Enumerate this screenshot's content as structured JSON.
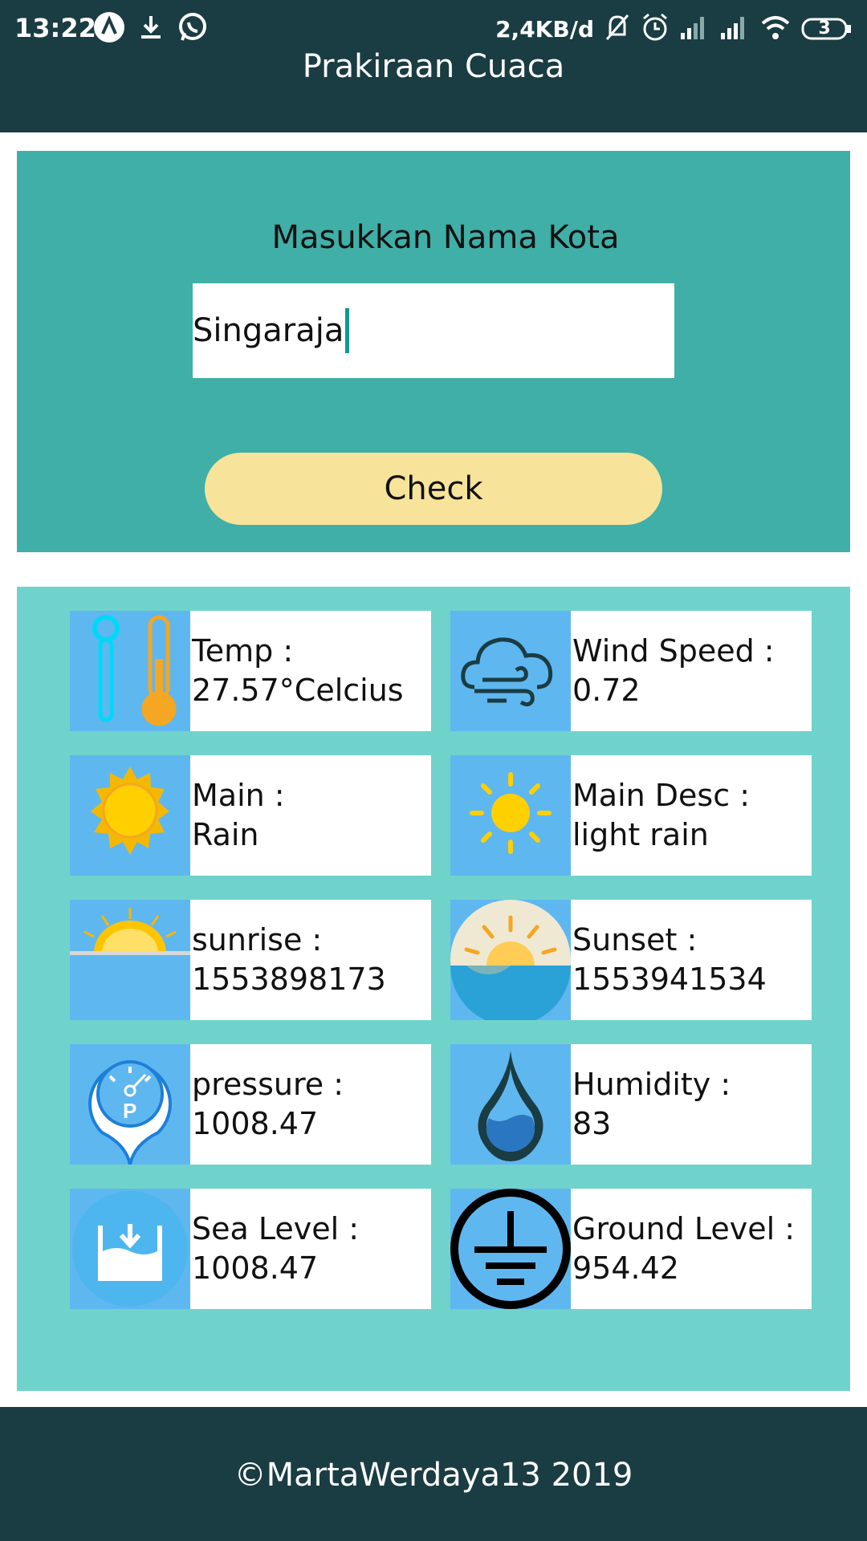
{
  "status_bar": {
    "time": "13:22",
    "speed": "2,4KB/d",
    "battery": "3",
    "icons": [
      "a-icon",
      "download-icon",
      "whatsapp-icon",
      "mute-bell-icon",
      "alarm-icon",
      "signal-icon",
      "signal-icon",
      "wifi-icon",
      "battery-icon"
    ]
  },
  "app": {
    "title": "Prakiraan Cuaca"
  },
  "search": {
    "prompt": "Masukkan Nama Kota",
    "city_value": "Singaraja",
    "button_label": "Check"
  },
  "colors": {
    "appbar": "#1a3c43",
    "search_panel": "#3fafa7",
    "grid_panel": "#6fd3cc",
    "check_button": "#f7e399",
    "icon_bg": "#5fb7f0"
  },
  "weather": [
    {
      "label": "Temp  :",
      "value": "27.57°Celcius",
      "icon": "thermometer-icon"
    },
    {
      "label": "Wind Speed  :",
      "value": "0.72",
      "icon": "cloud-wind-icon"
    },
    {
      "label": "Main  :",
      "value": "Rain",
      "icon": "sun-icon"
    },
    {
      "label": "Main Desc :",
      "value": "light rain",
      "icon": "sun-rays-icon"
    },
    {
      "label": "sunrise :",
      "value": "1553898173",
      "icon": "sunrise-icon"
    },
    {
      "label": "Sunset  :",
      "value": "1553941534",
      "icon": "sunset-icon"
    },
    {
      "label": "pressure  :",
      "value": "1008.47",
      "icon": "pressure-gauge-icon"
    },
    {
      "label": "Humidity  :",
      "value": "83",
      "icon": "water-drop-icon"
    },
    {
      "label": "Sea Level :",
      "value": "1008.47",
      "icon": "sea-level-icon"
    },
    {
      "label": "Ground Level  :",
      "value": "954.42",
      "icon": "ground-symbol-icon"
    }
  ],
  "footer": {
    "copyright": "©MartaWerdaya13 2019"
  }
}
